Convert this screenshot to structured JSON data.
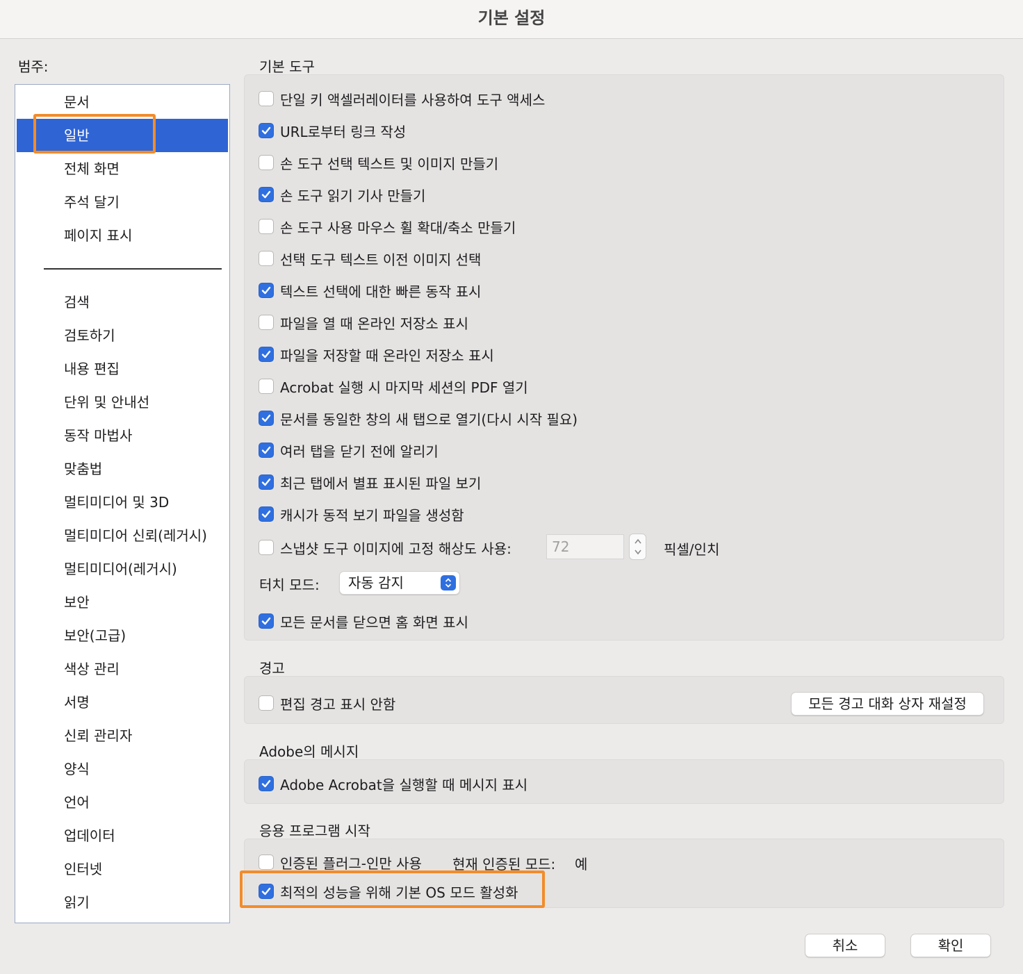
{
  "window": {
    "title": "기본 설정"
  },
  "categories": {
    "label": "범주:",
    "group1": [
      "문서",
      "일반",
      "전체 화면",
      "주석 달기",
      "페이지 표시"
    ],
    "group2": [
      "검색",
      "검토하기",
      "내용 편집",
      "단위 및 안내선",
      "동작 마법사",
      "맞춤법",
      "멀티미디어 및 3D",
      "멀티미디어 신뢰(레거시)",
      "멀티미디어(레거시)",
      "보안",
      "보안(고급)",
      "색상 관리",
      "서명",
      "신뢰 관리자",
      "양식",
      "언어",
      "업데이터",
      "인터넷",
      "읽기"
    ],
    "selected": "일반"
  },
  "basic_tools": {
    "title": "기본 도구",
    "options": [
      {
        "label": "단일 키 액셀러레이터를 사용하여 도구 액세스",
        "checked": false
      },
      {
        "label": "URL로부터 링크 작성",
        "checked": true
      },
      {
        "label": "손 도구 선택 텍스트 및 이미지 만들기",
        "checked": false
      },
      {
        "label": "손 도구 읽기 기사 만들기",
        "checked": true
      },
      {
        "label": "손 도구 사용 마우스 휠 확대/축소 만들기",
        "checked": false
      },
      {
        "label": "선택 도구 텍스트 이전 이미지 선택",
        "checked": false
      },
      {
        "label": "텍스트 선택에 대한 빠른 동작 표시",
        "checked": true
      },
      {
        "label": "파일을 열 때 온라인 저장소 표시",
        "checked": false
      },
      {
        "label": "파일을 저장할 때 온라인 저장소 표시",
        "checked": true
      },
      {
        "label": "Acrobat 실행 시 마지막 세션의 PDF 열기",
        "checked": false
      },
      {
        "label": "문서를 동일한 창의 새 탭으로 열기(다시 시작 필요)",
        "checked": true
      },
      {
        "label": "여러 탭을 닫기 전에 알리기",
        "checked": true
      },
      {
        "label": "최근 탭에서 별표 표시된 파일 보기",
        "checked": true
      },
      {
        "label": "캐시가 동적 보기 파일을 생성함",
        "checked": true
      },
      {
        "label": "스냅샷 도구 이미지에 고정 해상도 사용:",
        "checked": false
      }
    ],
    "resolution_value": "72",
    "resolution_unit": "픽셀/인치",
    "touch_mode_label": "터치 모드:",
    "touch_mode_value": "자동 감지",
    "home_on_close": {
      "label": "모든 문서를 닫으면 홈 화면 표시",
      "checked": true
    }
  },
  "warnings": {
    "title": "경고",
    "no_edit_warning": {
      "label": "편집 경고 표시 안함",
      "checked": false
    },
    "reset_button": "모든 경고 대화 상자 재설정"
  },
  "adobe_messages": {
    "title": "Adobe의 메시지",
    "show_on_launch": {
      "label": "Adobe Acrobat을 실행할 때 메시지 표시",
      "checked": true
    }
  },
  "app_startup": {
    "title": "응용 프로그램 시작",
    "certified_plugins": {
      "label": "인증된 플러그-인만 사용",
      "checked": false
    },
    "current_mode_label": "현재 인증된 모드:",
    "current_mode_value": "예",
    "native_os_mode": {
      "label": "최적의 성능을 위해 기본 OS 모드 활성화",
      "checked": true
    }
  },
  "footer": {
    "cancel": "취소",
    "ok": "확인"
  },
  "colors": {
    "accent": "#2f6fe0",
    "selection": "#2f64d4",
    "highlight": "#f28c2a"
  }
}
